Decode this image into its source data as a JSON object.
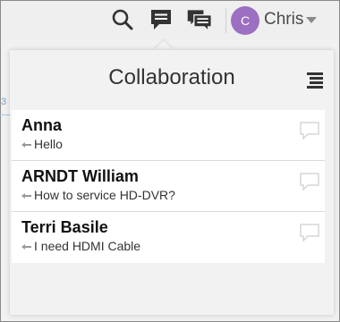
{
  "header": {
    "user_initial": "C",
    "user_name": "Chris",
    "icons": [
      "search-icon",
      "chat-bubble-icon",
      "chats-icon",
      "chevron-down-icon"
    ],
    "avatar_color": "#9c6fc2"
  },
  "background": {
    "partial_text": "3"
  },
  "popover": {
    "title": "Collaboration",
    "menu_icon": "list-menu-icon",
    "conversations": [
      {
        "name": "Anna",
        "last_message": "Hello"
      },
      {
        "name": "ARNDT William",
        "last_message": "How to service HD-DVR?"
      },
      {
        "name": "Terri Basile",
        "last_message": "I need HDMI Cable"
      }
    ]
  }
}
